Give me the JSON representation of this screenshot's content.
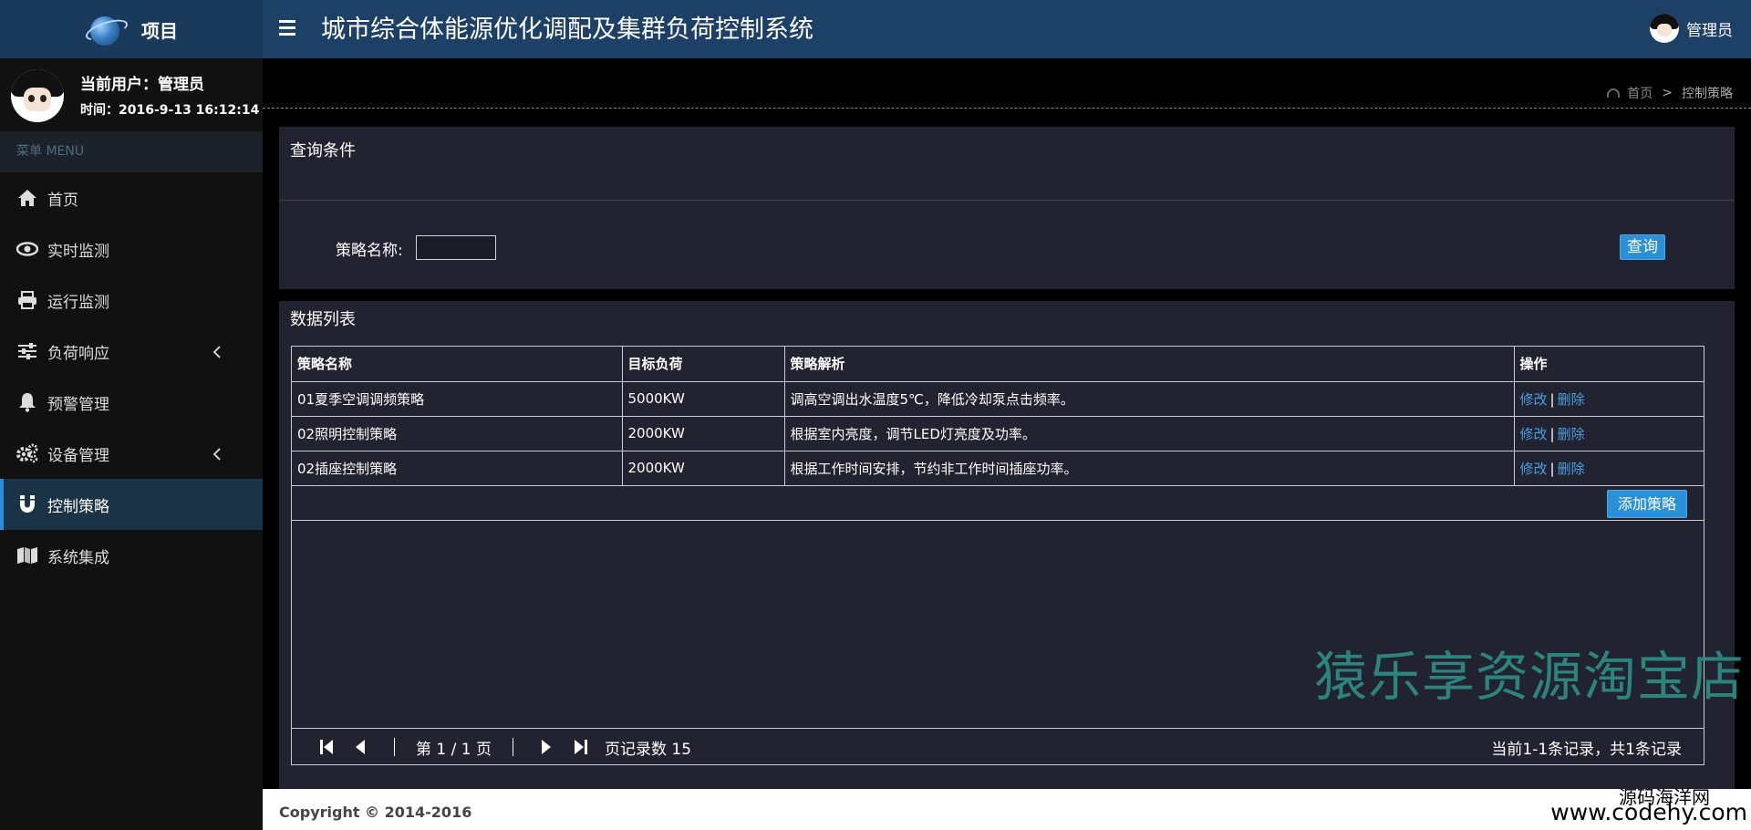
{
  "header": {
    "logo_title": "项目",
    "system_title": "城市综合体能源优化调配及集群负荷控制系统",
    "user_name": "管理员"
  },
  "sidebar": {
    "current_user": "当前用户：管理员",
    "time": "时间：2016-9-13 16:12:14",
    "menu_header": "菜单 MENU",
    "items": [
      {
        "label": "首页",
        "icon": "home-icon"
      },
      {
        "label": "实时监测",
        "icon": "eye-icon"
      },
      {
        "label": "运行监测",
        "icon": "printer-icon"
      },
      {
        "label": "负荷响应",
        "icon": "sliders-icon",
        "has_children": true
      },
      {
        "label": "预警管理",
        "icon": "bell-icon"
      },
      {
        "label": "设备管理",
        "icon": "gears-icon",
        "has_children": true
      },
      {
        "label": "控制策略",
        "icon": "magnet-icon",
        "active": true
      },
      {
        "label": "系统集成",
        "icon": "map-icon"
      }
    ]
  },
  "breadcrumb": {
    "home": "首页",
    "separator": ">",
    "current": "控制策略"
  },
  "query_panel": {
    "title": "查询条件",
    "field_label": "策略名称:",
    "field_value": "",
    "query_button": "查询"
  },
  "list_panel": {
    "title": "数据列表",
    "columns": [
      "策略名称",
      "目标负荷",
      "策略解析",
      "操作"
    ],
    "rows": [
      {
        "name": "01夏季空调调频策略",
        "load": "5000KW",
        "desc": "调高空调出水温度5℃，降低冷却泵点击频率。"
      },
      {
        "name": "02照明控制策略",
        "load": "2000KW",
        "desc": "根据室内亮度，调节LED灯亮度及功率。"
      },
      {
        "name": "02插座控制策略",
        "load": "2000KW",
        "desc": "根据工作时间安排，节约非工作时间插座功率。"
      }
    ],
    "edit_label": "修改",
    "action_sep": "|",
    "delete_label": "删除",
    "add_button": "添加策略",
    "pager": {
      "page_text": "第 1 / 1 页",
      "page_size_text": "页记录数 15",
      "summary": "当前1-1条记录，共1条记录"
    }
  },
  "footer": {
    "copyright": "Copyright © 2014-2016"
  },
  "watermarks": {
    "main": "猿乐享资源淘宝店",
    "site_cn": "源码海洋网",
    "site_url": "www.codehy.com"
  },
  "colors": {
    "topbar": "#1d4166",
    "sidebar": "#111111",
    "panel": "#212330",
    "accent": "#2a91d9",
    "link": "#4a9fe0",
    "watermark": "#2e8f86"
  }
}
